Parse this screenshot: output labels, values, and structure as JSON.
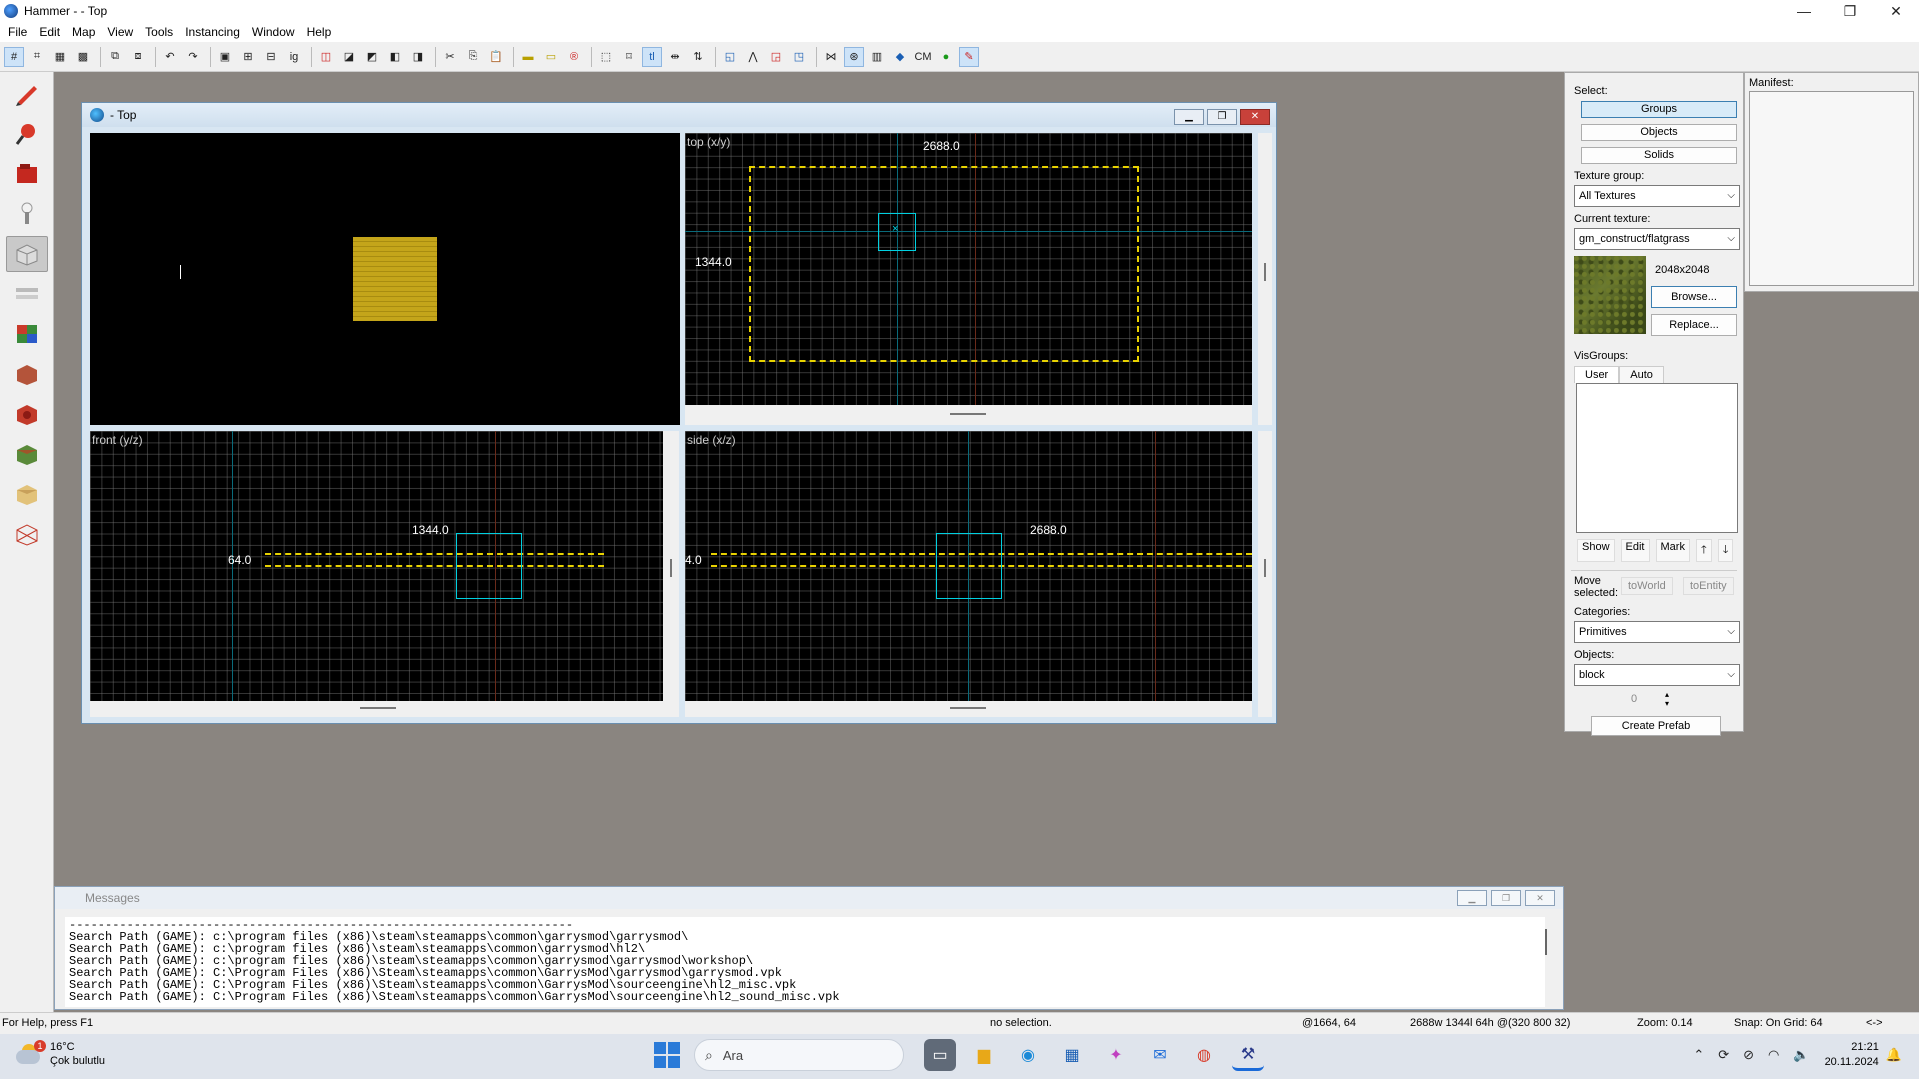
{
  "window": {
    "title": "Hammer -  - Top",
    "minimize": "—",
    "maximize": "❐",
    "close": "✕"
  },
  "menu": [
    "File",
    "Edit",
    "Map",
    "View",
    "Tools",
    "Instancing",
    "Window",
    "Help"
  ],
  "toolbar": {
    "cm_label": "CM"
  },
  "mdi": {
    "title": "- Top",
    "views": {
      "top_label": "top (x/y)",
      "front_label": "front (y/z)",
      "side_label": "side (x/z)",
      "top_width": "2688.0",
      "top_height": "1344.0",
      "front_width": "1344.0",
      "front_height": "64.0",
      "side_width": "2688.0",
      "side_height": "4.0"
    }
  },
  "right_panel": {
    "select_label": "Select:",
    "groups": "Groups",
    "objects": "Objects",
    "solids": "Solids",
    "texture_group_label": "Texture group:",
    "texture_group_value": "All Textures",
    "current_texture_label": "Current texture:",
    "current_texture_value": "gm_construct/flatgrass",
    "texture_size": "2048x2048",
    "browse": "Browse...",
    "replace": "Replace...",
    "visgroups_label": "VisGroups:",
    "tab_user": "User",
    "tab_auto": "Auto",
    "show": "Show",
    "edit": "Edit",
    "mark": "Mark",
    "up": "🡑",
    "down": "🡓",
    "move_selected_label": "Move selected:",
    "to_world": "toWorld",
    "to_entity": "toEntity",
    "categories_label": "Categories:",
    "categories_value": "Primitives",
    "objects_label": "Objects:",
    "objects_value": "block",
    "spinner_value": "0",
    "create_prefab": "Create Prefab"
  },
  "manifest": {
    "label": "Manifest:"
  },
  "messages": {
    "title": "Messages",
    "lines": [
      "----------------------------------------------------------------------",
      "Search Path (GAME): c:\\program files (x86)\\steam\\steamapps\\common\\garrysmod\\garrysmod\\",
      "Search Path (GAME): c:\\program files (x86)\\steam\\steamapps\\common\\garrysmod\\hl2\\",
      "Search Path (GAME): c:\\program files (x86)\\steam\\steamapps\\common\\garrysmod\\garrysmod\\workshop\\",
      "Search Path (GAME): C:\\Program Files (x86)\\Steam\\steamapps\\common\\GarrysMod\\garrysmod\\garrysmod.vpk",
      "Search Path (GAME): C:\\Program Files (x86)\\Steam\\steamapps\\common\\GarrysMod\\sourceengine\\hl2_misc.vpk",
      "Search Path (GAME): C:\\Program Files (x86)\\Steam\\steamapps\\common\\GarrysMod\\sourceengine\\hl2_sound_misc.vpk"
    ]
  },
  "status": {
    "help": "For Help, press F1",
    "selection": "no selection.",
    "coords": "@1664, 64",
    "size": "2688w 1344l 64h @(320 800 32)",
    "zoom": "Zoom: 0.14",
    "snap": "Snap: On Grid: 64",
    "arrows": "<->"
  },
  "taskbar": {
    "temperature": "16°C",
    "weather": "Çok bulutlu",
    "weather_badge": "1",
    "search_placeholder": "Ara",
    "time": "21:21",
    "date": "20.11.2024"
  }
}
